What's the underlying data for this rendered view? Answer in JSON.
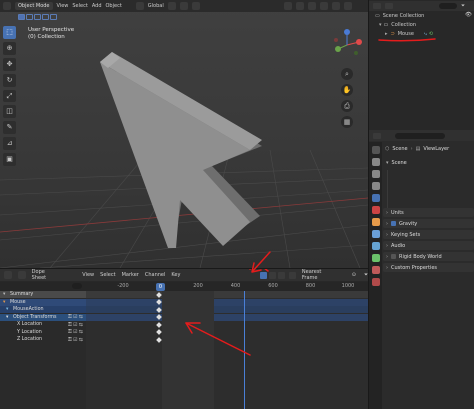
{
  "viewport": {
    "mode": "Object Mode",
    "menu": [
      "View",
      "Select",
      "Add",
      "Object"
    ],
    "transform_orientation": "Global",
    "info_line1": "User Perspective",
    "info_line2": "(0) Collection"
  },
  "outliner": {
    "root": "Scene Collection",
    "collection": "Collection",
    "object": "Mouse"
  },
  "properties": {
    "breadcrumb_scene": "Scene",
    "breadcrumb_layer": "ViewLayer",
    "panel_title": "Scene",
    "sections": [
      "Units",
      "Gravity",
      "Keying Sets",
      "Audio",
      "Rigid Body World",
      "Custom Properties"
    ]
  },
  "dopesheet": {
    "mode": "Dope Sheet",
    "menu": [
      "View",
      "Select",
      "Marker",
      "Channel",
      "Key"
    ],
    "snap_mode": "Nearest Frame",
    "current_frame": "0",
    "ruler_ticks": [
      "-200",
      "0",
      "200",
      "400",
      "600",
      "800",
      "1000"
    ],
    "channels": [
      {
        "label": "Summary"
      },
      {
        "label": "Mouse"
      },
      {
        "label": "MouseAction"
      },
      {
        "label": "Object Transforms"
      },
      {
        "label": "X Location"
      },
      {
        "label": "Y Location"
      },
      {
        "label": "Z Location"
      }
    ]
  },
  "colors": {
    "annotation_red": "#e41c1c",
    "selection_blue": "#4772b3"
  }
}
